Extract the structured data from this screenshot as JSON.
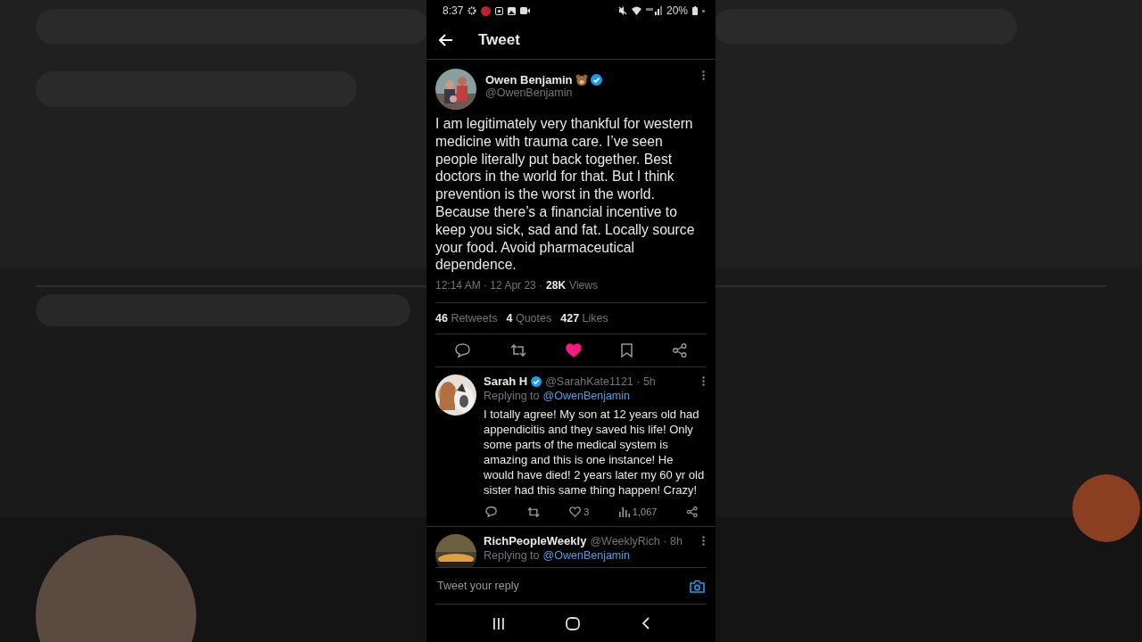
{
  "status_bar": {
    "time": "8:37",
    "battery": "20%"
  },
  "header": {
    "title": "Tweet"
  },
  "tweet": {
    "author": "Owen Benjamin",
    "verified": true,
    "handle": "@OwenBenjamin",
    "text": "I am legitimately very thankful for western medicine with trauma care. I’ve seen people literally put back together. Best doctors in the world for that. But I think prevention is the worst in the world. Because there’s a financial incentive to keep you sick, sad and fat. Locally source your food. Avoid pharmaceutical dependence.",
    "time": "12:14 AM · 12 Apr 23 ·",
    "views_count": "28K",
    "views_label": "Views",
    "stats": [
      {
        "count": "46",
        "label": "Retweets"
      },
      {
        "count": "4",
        "label": "Quotes"
      },
      {
        "count": "427",
        "label": "Likes"
      }
    ],
    "liked": true
  },
  "replies": [
    {
      "author": "Sarah H",
      "verified": true,
      "handle": "@SarahKate1121 · 5h",
      "replying_label": "Replying to",
      "replying_to": "@OwenBenjamin",
      "text": "I totally agree! My son at 12 years old had appendicitis and they saved his life! Only some parts of the medical system is amazing and this is one instance! He would have died! 2 years later my 60 yr old sister had this same thing happen! Crazy!",
      "likes": "3",
      "views": "1,067",
      "liked": false
    },
    {
      "author": "RichPeopleWeekly",
      "verified": false,
      "handle": "@WeeklyRich · 8h",
      "replying_label": "Replying to",
      "replying_to": "@OwenBenjamin"
    }
  ],
  "reply_bar": {
    "placeholder": "Tweet your reply"
  }
}
